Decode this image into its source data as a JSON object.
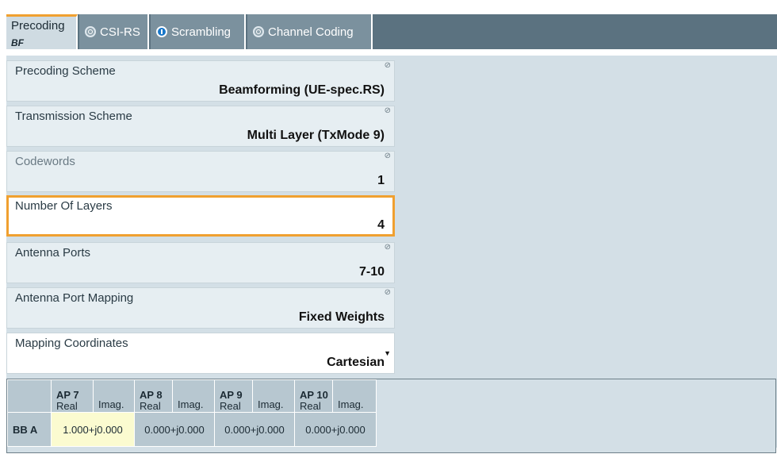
{
  "tabs": [
    {
      "label": "Precoding",
      "sublabel": "BF"
    },
    {
      "label": "CSI-RS",
      "toggle": "off"
    },
    {
      "label": "Scrambling",
      "toggle": "on"
    },
    {
      "label": "Channel Coding",
      "toggle": "off"
    }
  ],
  "fields": {
    "precoding_scheme": {
      "label": "Precoding Scheme",
      "value": "Beamforming (UE-spec.RS)"
    },
    "transmission_scheme": {
      "label": "Transmission Scheme",
      "value": "Multi Layer (TxMode 9)"
    },
    "codewords": {
      "label": "Codewords",
      "value": "1"
    },
    "number_of_layers": {
      "label": "Number Of Layers",
      "value": "4"
    },
    "antenna_ports": {
      "label": "Antenna Ports",
      "value": "7-10"
    },
    "antenna_port_mapping": {
      "label": "Antenna Port Mapping",
      "value": "Fixed Weights"
    },
    "mapping_coordinates": {
      "label": "Mapping Coordinates",
      "value": "Cartesian"
    }
  },
  "table": {
    "columns": [
      "AP 7",
      "AP 8",
      "AP 9",
      "AP 10"
    ],
    "real_label": "Real",
    "imag_label": "Imag.",
    "rows": [
      {
        "label": "BB A",
        "cells": [
          "1.000+j0.000",
          "0.000+j0.000",
          "0.000+j0.000",
          "0.000+j0.000"
        ]
      }
    ]
  },
  "colors": {
    "accent": "#f0a030",
    "tab_bar": "#5b7280",
    "panel": "#d3dfe6",
    "toggle_on": "#1877c9"
  }
}
